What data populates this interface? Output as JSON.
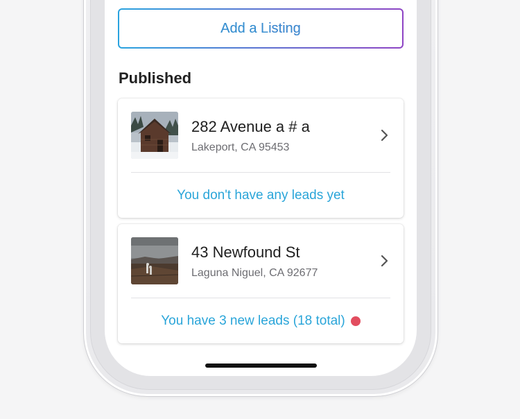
{
  "actions": {
    "add_listing_label": "Add a Listing"
  },
  "section": {
    "title": "Published"
  },
  "listings": [
    {
      "address": "282 Avenue a # a",
      "city": "Lakeport, CA 95453",
      "leads_text": "You don't have any leads yet",
      "has_new_indicator": false,
      "thumbnail": "cabin-in-snow-photo"
    },
    {
      "address": "43 Newfound St",
      "city": "Laguna Niguel, CA 92677",
      "leads_text": "You have 3 new leads (18 total)",
      "has_new_indicator": true,
      "thumbnail": "moorland-landscape-photo"
    }
  ],
  "colors": {
    "accent_blue": "#2aa5d9",
    "accent_purple": "#8e44c4",
    "new_lead_dot": "#e24d5f"
  },
  "icons": {
    "row_chevron": "chevron-right-icon"
  }
}
